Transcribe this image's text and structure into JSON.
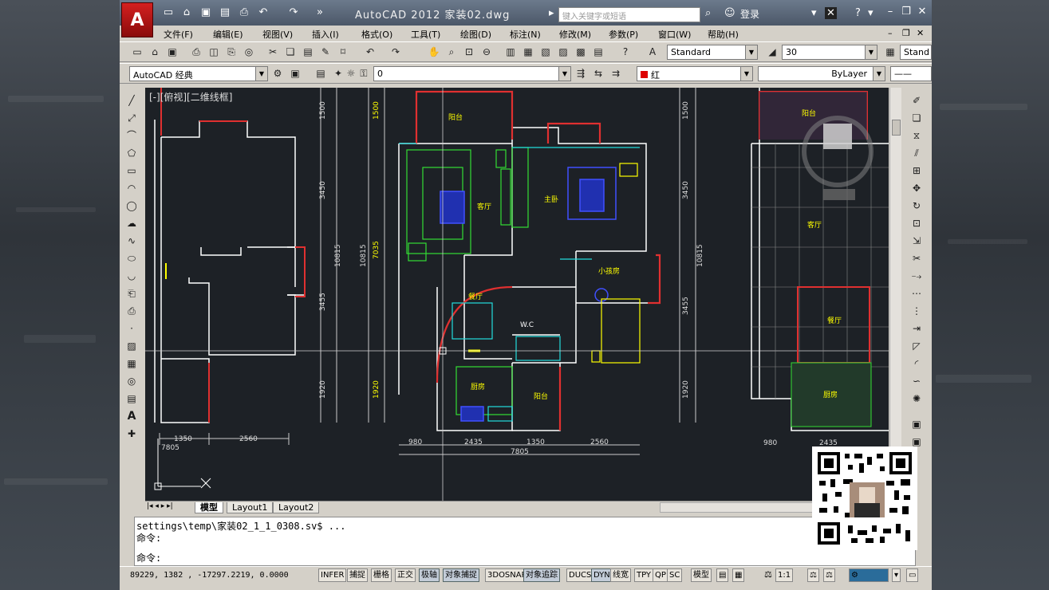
{
  "window": {
    "title": "AutoCAD 2012    家装02.dwg",
    "search_placeholder": "键入关键字或短语",
    "login_label": "登录",
    "logo_letter": "A"
  },
  "menu": [
    "文件(F)",
    "编辑(E)",
    "视图(V)",
    "插入(I)",
    "格式(O)",
    "工具(T)",
    "绘图(D)",
    "标注(N)",
    "修改(M)",
    "参数(P)",
    "窗口(W)",
    "帮助(H)"
  ],
  "toolbar1": {
    "text_style": "Standard",
    "dim_scale": "30",
    "table_style": "Stand"
  },
  "toolbar2": {
    "workspace": "AutoCAD 经典",
    "layer": "0",
    "color": "红",
    "linetype": "ByLayer"
  },
  "viewport": {
    "label": "[-][俯视][二维线框]"
  },
  "drawing_text": {
    "balcony": "阳台",
    "living": "客厅",
    "master": "主卧",
    "small_bedroom": "小孩房",
    "dining": "餐厅",
    "wc": "W.C",
    "kitchen": "厨房",
    "balcony2": "阳台",
    "r_balcony": "阳台",
    "r_living": "客厅",
    "r_dining": "餐厅",
    "r_kitchen": "厨房",
    "dim_1350": "1350",
    "dim_2560": "2560",
    "dim_7805": "7805",
    "dim_980": "980",
    "dim_2435": "2435",
    "dim_1500": "1500",
    "dim_3450": "3450",
    "dim_3455": "3455",
    "dim_1920": "1920",
    "dim_10815": "10815",
    "dim_7035": "7035"
  },
  "layout_tabs": [
    "模型",
    "Layout1",
    "Layout2"
  ],
  "command": {
    "line1": "settings\\temp\\家装02_1_1_0308.sv$ ...",
    "line2": "命令:",
    "line3": "命令:"
  },
  "status": {
    "coords": "89229, 1382  , -17297.2219, 0.0000",
    "buttons": [
      "INFER",
      "捕捉",
      "栅格",
      "正交",
      "极轴",
      "对象捕捉",
      "3DOSNAP",
      "对象追踪",
      "DUCS",
      "DYN",
      "线宽",
      "TPY",
      "QP",
      "SC"
    ],
    "model_label": "模型",
    "scale": "1:1"
  },
  "colors": {
    "wall": "#ffffff",
    "red": "#e03030",
    "green": "#33dd33",
    "yellow": "#ffff00",
    "cyan": "#22dddd",
    "blue": "#4050ff",
    "background": "#1d2126"
  }
}
